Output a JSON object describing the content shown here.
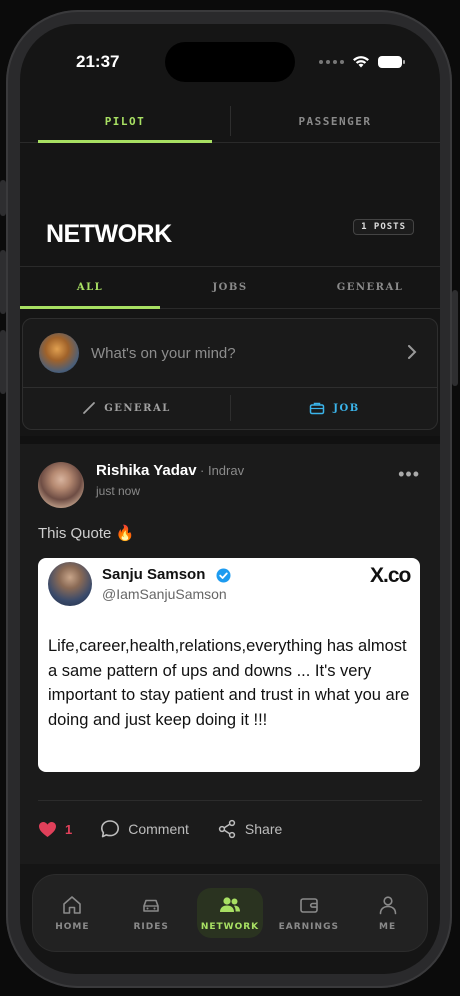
{
  "status": {
    "time": "21:37"
  },
  "role_tabs": [
    {
      "label": "PILOT",
      "active": true
    },
    {
      "label": "PASSENGER",
      "active": false
    }
  ],
  "network": {
    "title": "NETWORK",
    "posts_badge": "1 POSTS"
  },
  "filter_tabs": [
    {
      "label": "ALL",
      "active": true
    },
    {
      "label": "JOBS",
      "active": false
    },
    {
      "label": "GENERAL",
      "active": false
    }
  ],
  "composer": {
    "placeholder": "What's on your mind?",
    "general_label": "GENERAL",
    "job_label": "JOB"
  },
  "post": {
    "author": "Rishika Yadav",
    "meta_separator": "·",
    "location": "Indrav",
    "time": "just now",
    "text": "This Quote 🔥",
    "likes": "1",
    "comment_label": "Comment",
    "share_label": "Share",
    "tweet": {
      "name": "Sanju Samson",
      "handle": "@IamSanjuSamson",
      "brand": "X.co",
      "body": "Life,career,health,relations,everything has almost a same pattern of ups and downs ... It's very important to stay patient and trust in what you are doing and just keep doing it !!!"
    }
  },
  "bottom_nav": [
    {
      "label": "HOME",
      "icon": "home-icon",
      "active": false
    },
    {
      "label": "RIDES",
      "icon": "car-icon",
      "active": false
    },
    {
      "label": "NETWORK",
      "icon": "people-icon",
      "active": true
    },
    {
      "label": "EARNINGS",
      "icon": "wallet-icon",
      "active": false
    },
    {
      "label": "ME",
      "icon": "person-icon",
      "active": false
    }
  ],
  "colors": {
    "accent": "#a8e063",
    "job_blue": "#3bb4ea",
    "like_red": "#e0405a",
    "background": "#151515"
  }
}
